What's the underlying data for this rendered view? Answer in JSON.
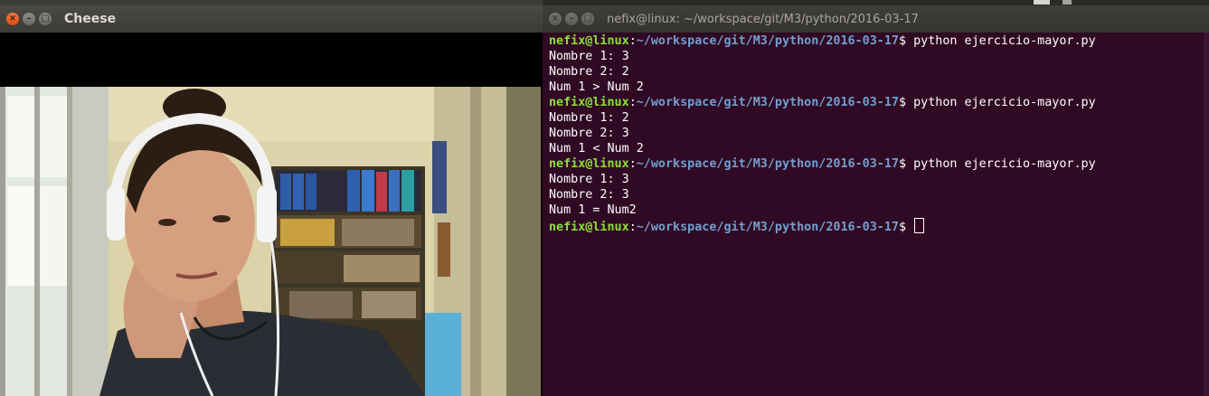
{
  "cheese": {
    "title": "Cheese",
    "buttons": {
      "close": "×",
      "minimize": "–",
      "maximize": "□"
    }
  },
  "terminal": {
    "title": "nefix@linux: ~/workspace/git/M3/python/2016-03-17",
    "buttons": {
      "close": "×",
      "minimize": "–",
      "maximize": "□"
    },
    "prompt_user": "nefix@linux",
    "prompt_sep": ":",
    "prompt_path": "~/workspace/git/M3/python/2016-03-17",
    "prompt_end": "$ ",
    "lines": [
      {
        "type": "prompt",
        "cmd": "python ejercicio-mayor.py"
      },
      {
        "type": "out",
        "text": "Nombre 1: 3"
      },
      {
        "type": "out",
        "text": "Nombre 2: 2"
      },
      {
        "type": "out",
        "text": "Num 1 > Num 2"
      },
      {
        "type": "prompt",
        "cmd": "python ejercicio-mayor.py"
      },
      {
        "type": "out",
        "text": "Nombre 1: 2"
      },
      {
        "type": "out",
        "text": "Nombre 2: 3"
      },
      {
        "type": "out",
        "text": "Num 1 < Num 2"
      },
      {
        "type": "prompt",
        "cmd": "python ejercicio-mayor.py"
      },
      {
        "type": "out",
        "text": "Nombre 1: 3"
      },
      {
        "type": "out",
        "text": "Nombre 2: 3"
      },
      {
        "type": "out",
        "text": "Num 1 = Num2"
      },
      {
        "type": "prompt",
        "cmd": "",
        "cursor": true
      }
    ]
  },
  "colors": {
    "terminal_bg": "#300a24",
    "prompt_user": "#8ae234",
    "prompt_path": "#729fcf",
    "close_button": "#df4a16"
  }
}
